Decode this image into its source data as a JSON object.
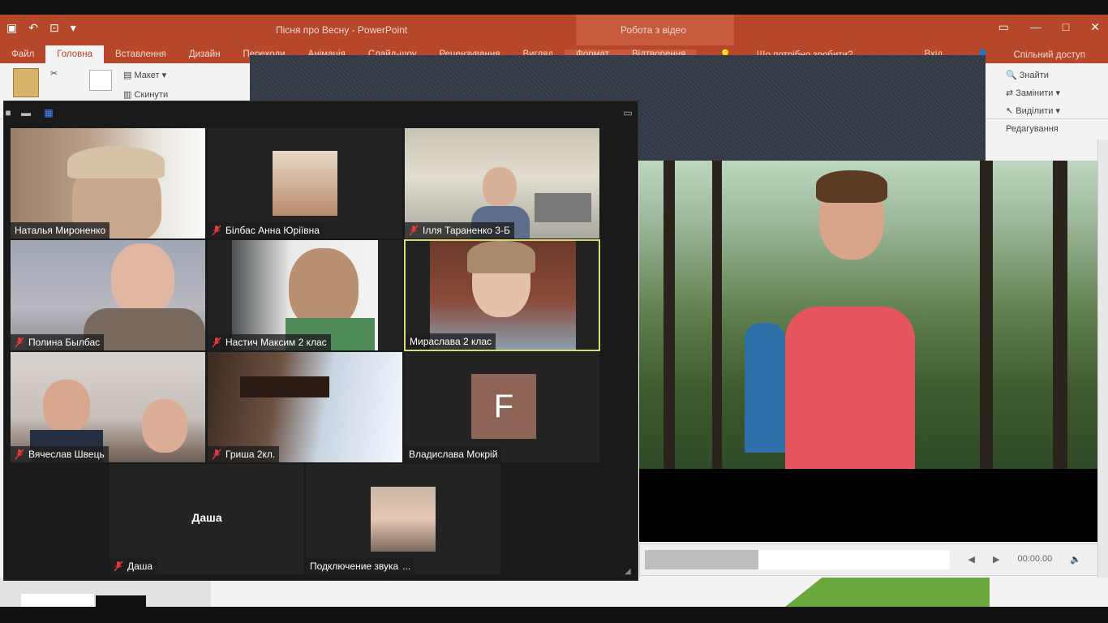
{
  "ppt": {
    "title": "Пісня про Весну - PowerPoint",
    "context_title": "Робота з відео",
    "tabs": [
      "Файл",
      "Головна",
      "Вставлення",
      "Дизайн",
      "Переходи",
      "Анімація",
      "Слайд-шоу",
      "Рецензування",
      "Вигляд",
      "Формат",
      "Відтворення"
    ],
    "tell_me": "Що потрібно зробити?",
    "sign_in": "Вхід",
    "share": "Спільний доступ",
    "ribbon_layout": "Макет",
    "ribbon_reset": "Скинути",
    "ribbon_right": [
      "Знайти",
      "Замінити",
      "Виділити",
      "Редагування"
    ],
    "video_time": "00:00.00"
  },
  "zoom": {
    "participants": [
      {
        "name": "Наталья Мироненко",
        "muted": false,
        "active": false
      },
      {
        "name": "Білбас Анна Юріївна",
        "muted": true,
        "active": false
      },
      {
        "name": "Ілля Тараненко 3-Б",
        "muted": true,
        "active": false
      },
      {
        "name": "Полина Былбас",
        "muted": true,
        "active": false
      },
      {
        "name": "Настич Максим 2 клас",
        "muted": true,
        "active": false
      },
      {
        "name": "Мираслава 2 клас",
        "muted": false,
        "active": true
      },
      {
        "name": "Вячеслав Швець",
        "muted": true,
        "active": false
      },
      {
        "name": "Гриша 2кл.",
        "muted": true,
        "active": false
      },
      {
        "name": "Владислава Мокрій",
        "muted": false,
        "active": false,
        "avatar_letter": "F",
        "avatar_color": "#8d6455"
      },
      {
        "name": "Даша",
        "muted": true,
        "active": false,
        "center_label": "Даша"
      },
      {
        "name": "Подключение звука",
        "muted": false,
        "active": false,
        "connecting": "..."
      }
    ]
  },
  "colors": {
    "ppt_accent": "#b7472a",
    "active_speaker": "#d8dc6a"
  }
}
